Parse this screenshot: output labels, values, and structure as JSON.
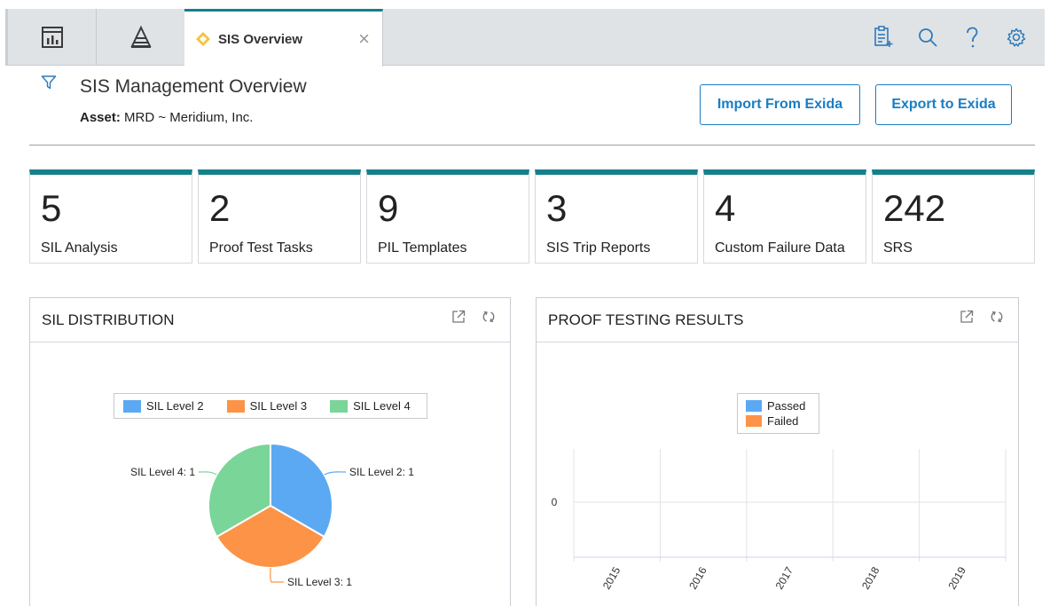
{
  "tabs": {
    "active_tab_label": "SIS Overview"
  },
  "header": {
    "title": "SIS Management Overview",
    "asset_key": "Asset:",
    "asset_value": "MRD ~ Meridium, Inc.",
    "import_label": "Import From Exida",
    "export_label": "Export to Exida"
  },
  "kpis": [
    {
      "value": "5",
      "label": "SIL Analysis"
    },
    {
      "value": "2",
      "label": "Proof Test Tasks"
    },
    {
      "value": "9",
      "label": "PIL Templates"
    },
    {
      "value": "3",
      "label": "SIS Trip Reports"
    },
    {
      "value": "4",
      "label": "Custom Failure Data"
    },
    {
      "value": "242",
      "label": "SRS"
    }
  ],
  "widgets": {
    "sil": {
      "title": "SIL DISTRIBUTION",
      "legend": [
        "SIL Level 2",
        "SIL Level 3",
        "SIL Level 4"
      ]
    },
    "proof": {
      "title": "PROOF TESTING RESULTS",
      "legend": [
        "Passed",
        "Failed"
      ]
    }
  },
  "colors": {
    "accent": "#15808a",
    "link": "#1a7dc4",
    "sil2": "#5ba9f3",
    "sil3": "#fd9346",
    "sil4": "#7ad599",
    "passed": "#5ba9f3",
    "failed": "#fd9346"
  },
  "chart_data": [
    {
      "type": "pie",
      "title": "SIL DISTRIBUTION",
      "categories": [
        "SIL Level 2",
        "SIL Level 3",
        "SIL Level 4"
      ],
      "values": [
        1,
        1,
        1
      ],
      "data_labels": [
        "SIL Level 2: 1",
        "SIL Level 3: 1",
        "SIL Level 4: 1"
      ],
      "legend": "top"
    },
    {
      "type": "bar",
      "title": "PROOF TESTING RESULTS",
      "categories": [
        "2015",
        "2016",
        "2017",
        "2018",
        "2019"
      ],
      "series": [
        {
          "name": "Passed",
          "values": [
            0,
            0,
            0,
            0,
            0
          ]
        },
        {
          "name": "Failed",
          "values": [
            0,
            0,
            0,
            0,
            0
          ]
        }
      ],
      "y_ticks": [
        "0"
      ],
      "legend": "top",
      "grid": true
    }
  ]
}
